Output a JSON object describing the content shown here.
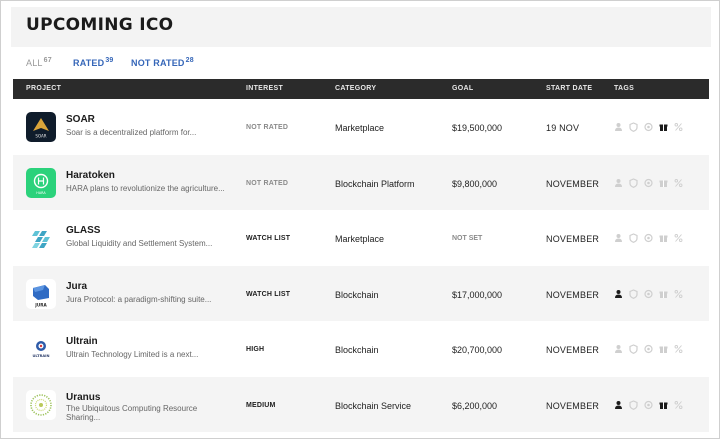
{
  "page": {
    "title": "UPCOMING ICO"
  },
  "filters": [
    {
      "label": "ALL",
      "count": "67",
      "active": false
    },
    {
      "label": "RATED",
      "count": "39",
      "active": true
    },
    {
      "label": "NOT RATED",
      "count": "28",
      "active": true
    }
  ],
  "columns": [
    "PROJECT",
    "INTEREST",
    "CATEGORY",
    "GOAL",
    "START DATE",
    "TAGS"
  ],
  "colors": {
    "header_bg": "#2b2b2b",
    "link": "#3566b8",
    "tag_active": "#1c1c1c",
    "tag_inactive": "#cfcfcf"
  },
  "tag_icons": [
    "person-icon",
    "shield-icon",
    "coin-icon",
    "gift-icon",
    "percent-icon"
  ],
  "rows": [
    {
      "name": "SOAR",
      "desc": "Soar is a decentralized platform for...",
      "interest": "NOT RATED",
      "category": "Marketplace",
      "goal": "$19,500,000",
      "start": "19 NOV",
      "tags": [
        false,
        false,
        false,
        true,
        false
      ],
      "logo": "soar"
    },
    {
      "name": "Haratoken",
      "desc": "HARA plans to revolutionize the agriculture...",
      "interest": "NOT RATED",
      "category": "Blockchain Platform",
      "goal": "$9,800,000",
      "start": "NOVEMBER",
      "tags": [
        false,
        false,
        false,
        false,
        false
      ],
      "logo": "hara"
    },
    {
      "name": "GLASS",
      "desc": "Global Liquidity and Settlement System...",
      "interest": "WATCH LIST",
      "category": "Marketplace",
      "goal": "NOT SET",
      "start": "NOVEMBER",
      "tags": [
        false,
        false,
        false,
        false,
        false
      ],
      "logo": "glass"
    },
    {
      "name": "Jura",
      "desc": "Jura Protocol: a paradigm-shifting suite...",
      "interest": "WATCH LIST",
      "category": "Blockchain",
      "goal": "$17,000,000",
      "start": "NOVEMBER",
      "tags": [
        true,
        false,
        false,
        false,
        false
      ],
      "logo": "jura"
    },
    {
      "name": "Ultrain",
      "desc": "Ultrain Technology Limited is a next...",
      "interest": "HIGH",
      "category": "Blockchain",
      "goal": "$20,700,000",
      "start": "NOVEMBER",
      "tags": [
        false,
        false,
        false,
        false,
        false
      ],
      "logo": "ultrain"
    },
    {
      "name": "Uranus",
      "desc": "The Ubiquitous Computing Resource Sharing...",
      "interest": "MEDIUM",
      "category": "Blockchain Service",
      "goal": "$6,200,000",
      "start": "NOVEMBER",
      "tags": [
        true,
        false,
        false,
        true,
        false
      ],
      "logo": "uranus"
    }
  ]
}
